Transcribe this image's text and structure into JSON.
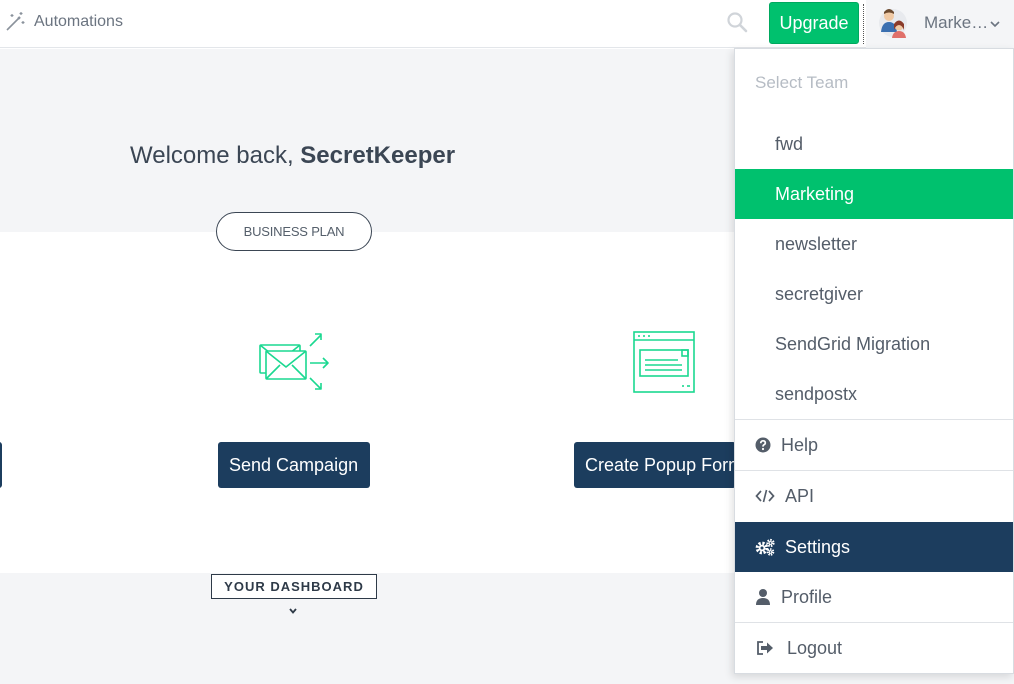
{
  "topbar": {
    "automations_label": "Automations",
    "upgrade_label": "Upgrade",
    "current_team": "Marke…"
  },
  "welcome": {
    "prefix": "Welcome back, ",
    "username": "SecretKeeper",
    "plan": "BUSINESS PLAN"
  },
  "actions": {
    "send_campaign": "Send Campaign",
    "create_popup": "Create Popup Form"
  },
  "dashboard": {
    "label": "YOUR DASHBOARD"
  },
  "dropdown": {
    "select_team_label": "Select Team",
    "teams": [
      {
        "label": "fwd"
      },
      {
        "label": "Marketing"
      },
      {
        "label": "newsletter"
      },
      {
        "label": "secretgiver"
      },
      {
        "label": "SendGrid Migration"
      },
      {
        "label": "sendpostx"
      }
    ],
    "menu": [
      {
        "label": "Help",
        "icon": "question-circle-icon"
      },
      {
        "label": "API",
        "icon": "code-icon"
      },
      {
        "label": "Settings",
        "icon": "gears-icon"
      },
      {
        "label": "Profile",
        "icon": "user-icon"
      },
      {
        "label": "Logout",
        "icon": "sign-out-icon"
      }
    ]
  },
  "colors": {
    "brand_green": "#00c16e",
    "navy": "#1c3d5e",
    "band_bg": "#f4f5f7"
  }
}
